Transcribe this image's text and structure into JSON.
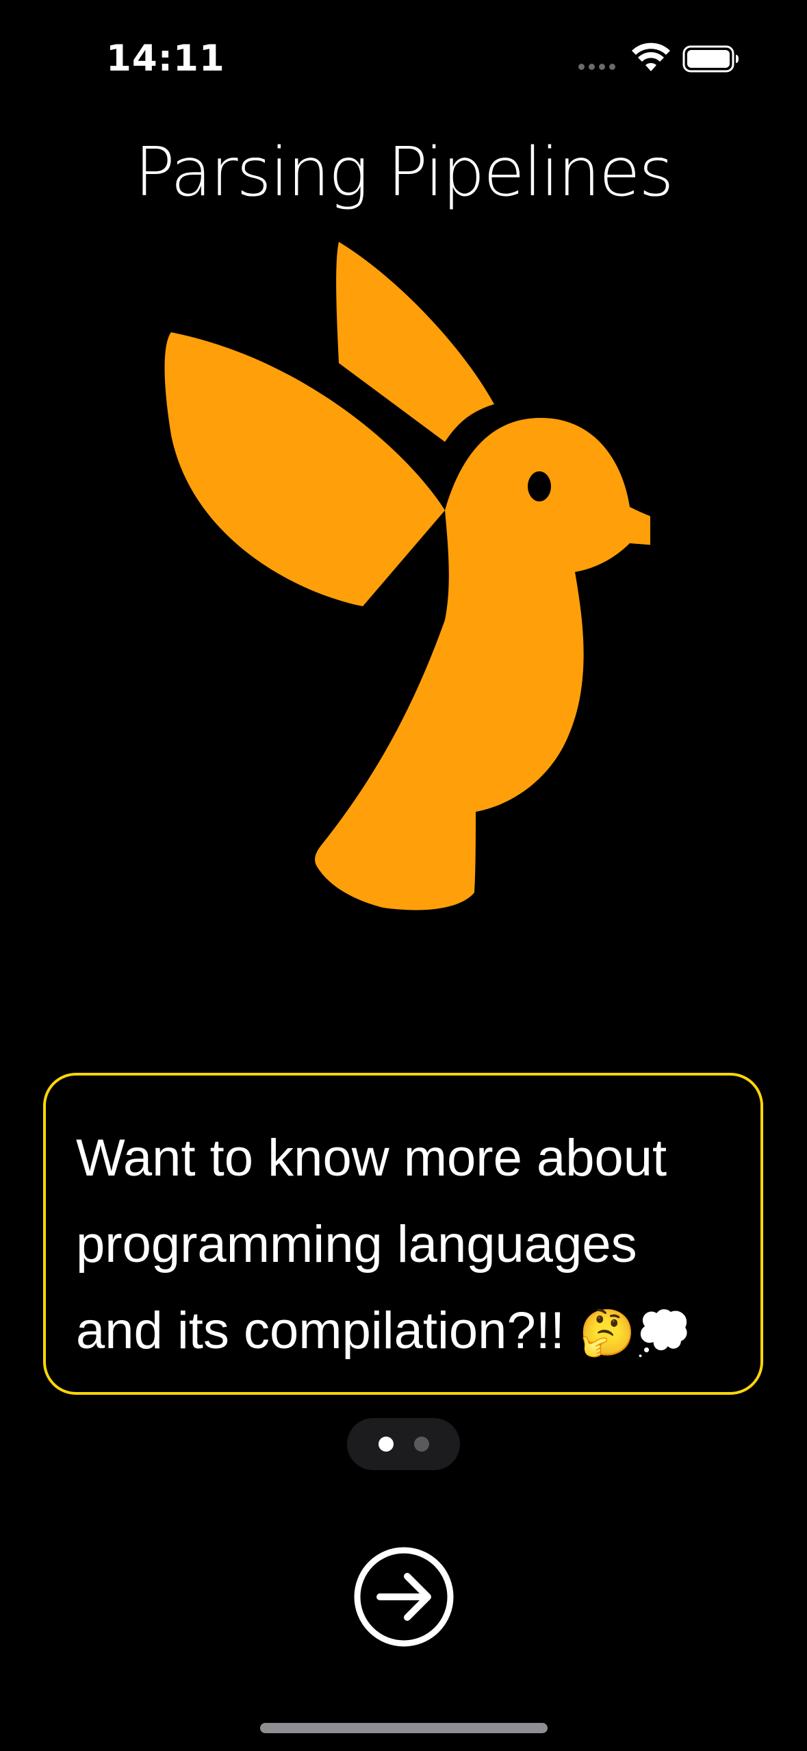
{
  "status_bar": {
    "time": "14:11",
    "icons": [
      "cellular-signal-icon",
      "wifi-icon",
      "battery-icon"
    ]
  },
  "app": {
    "title": "Parsing Pipelines",
    "logo_icon": "hummingbird-icon",
    "accent_color": "#ff9f0a"
  },
  "card": {
    "message": "Want to know more about\nprogramming languages\nand its compilation?!! ",
    "emoji": "🤔💭",
    "border_color": "#ffd60a"
  },
  "pagination": {
    "total_pages": 2,
    "current_page": 1,
    "active_color": "#ffffff",
    "inactive_color": "#5a5a5e"
  },
  "actions": {
    "next_icon": "arrow-right-circle-icon"
  }
}
